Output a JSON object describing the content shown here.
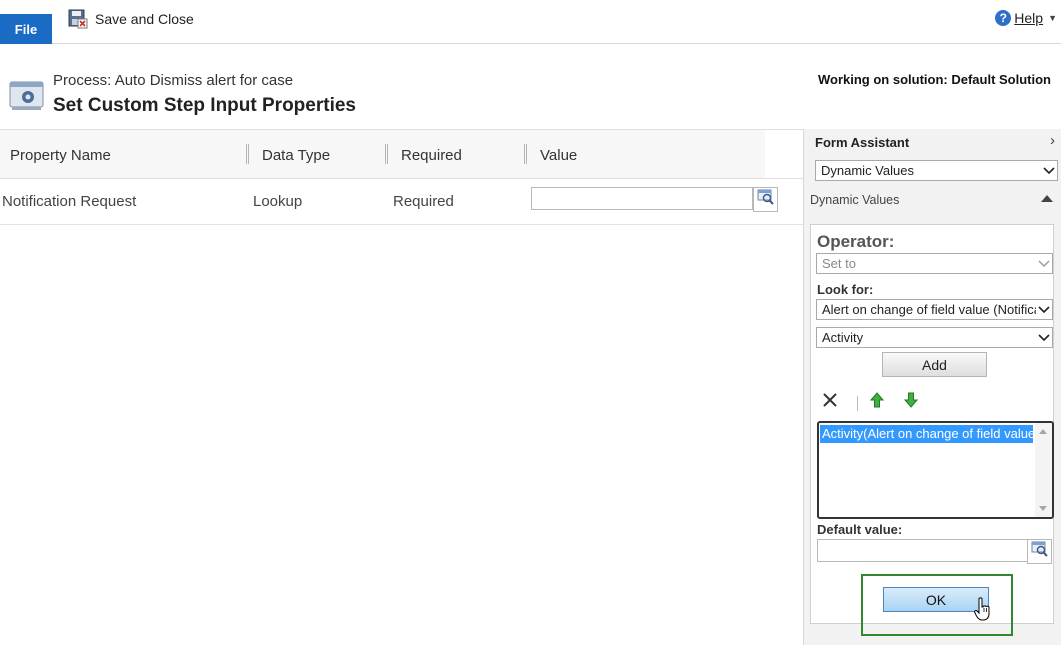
{
  "ribbon": {
    "file_label": "File",
    "save_close_label": "Save and Close",
    "help_label": "Help"
  },
  "header": {
    "process_label": "Process: Auto Dismiss alert for case",
    "title": "Set Custom Step Input Properties",
    "solution_text": "Working on solution: Default Solution"
  },
  "grid": {
    "columns": [
      "Property Name",
      "Data Type",
      "Required",
      "Value"
    ],
    "rows": [
      {
        "property_name": "Notification Request",
        "data_type": "Lookup",
        "required": "Required",
        "value": ""
      }
    ]
  },
  "form_assistant": {
    "title": "Form Assistant",
    "view_select": "Dynamic Values",
    "section_label": "Dynamic Values",
    "operator_label": "Operator:",
    "operator_value": "Set to",
    "look_for_label": "Look for:",
    "look_for_value": "Alert on change of field value (Notification Request)",
    "field_value": "Activity",
    "add_label": "Add",
    "selected_values": [
      "Activity(Alert on change of field value (Notification Request))"
    ],
    "default_value_label": "Default value:",
    "default_value": "",
    "ok_label": "OK"
  },
  "icons": [
    "save-close-icon",
    "help-icon",
    "process-icon",
    "lookup-icon",
    "chevron-right-icon",
    "chevron-down-icon",
    "collapse-up-icon",
    "delete-x-icon",
    "move-up-icon",
    "move-down-icon",
    "hand-cursor-icon"
  ],
  "colors": {
    "file_tab": "#1a6bc4",
    "ok_highlight": "#2f8a2f",
    "list_selection": "#3399ff",
    "ok_button": "#a9d3f3"
  }
}
